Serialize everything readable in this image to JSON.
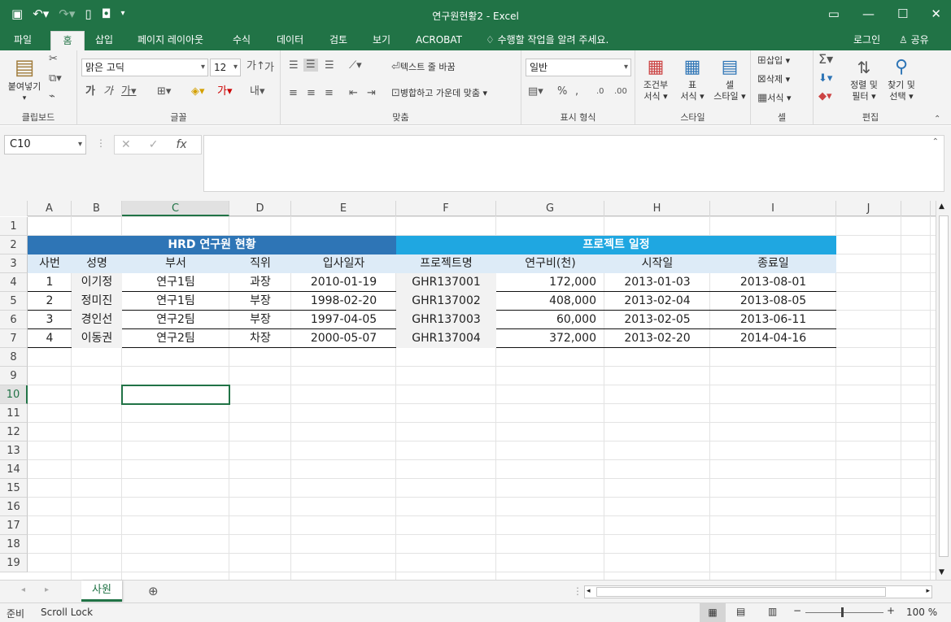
{
  "window": {
    "title": "연구원현황2 - Excel"
  },
  "tabs": [
    "파일",
    "홈",
    "삽입",
    "페이지 레이아웃",
    "수식",
    "데이터",
    "검토",
    "보기",
    "ACROBAT"
  ],
  "tellme": "수행할 작업을 알려 주세요.",
  "login": "로그인",
  "share": "공유",
  "ribbon": {
    "paste": "붙여넣기",
    "clipboard": "클립보드",
    "font_name": "맑은 고딕",
    "font_size": "12",
    "font": "글꼴",
    "wrap_text": "텍스트 줄 바꿈",
    "merge_center": "병합하고 가운데 맞춤",
    "alignment": "맞춤",
    "number_format": "일반",
    "number": "표시 형식",
    "cond_format1": "조건부",
    "cond_format2": "서식",
    "format_table1": "표",
    "format_table2": "서식",
    "cell_styles1": "셀",
    "cell_styles2": "스타일",
    "styles": "스타일",
    "insert": "삽입",
    "delete": "삭제",
    "format": "서식",
    "cells": "셀",
    "sort1": "정렬 및",
    "sort2": "필터",
    "find1": "찾기 및",
    "find2": "선택",
    "editing": "편집"
  },
  "namebox": "C10",
  "columns": [
    "A",
    "B",
    "C",
    "D",
    "E",
    "F",
    "G",
    "H",
    "I",
    "J"
  ],
  "rows": [
    "1",
    "2",
    "3",
    "4",
    "5",
    "6",
    "7",
    "8",
    "9",
    "10",
    "11",
    "12",
    "13",
    "14",
    "15",
    "16",
    "17",
    "18",
    "19"
  ],
  "table": {
    "title_left": "HRD 연구원 현황",
    "title_right": "프로젝트 일정",
    "headers": [
      "사번",
      "성명",
      "부서",
      "직위",
      "입사일자",
      "프로젝트명",
      "연구비(천)",
      "시작일",
      "종료일"
    ],
    "rows": [
      [
        "1",
        "이기정",
        "연구1팀",
        "과장",
        "2010-01-19",
        "GHR137001",
        "172,000",
        "2013-01-03",
        "2013-08-01"
      ],
      [
        "2",
        "정미진",
        "연구1팀",
        "부장",
        "1998-02-20",
        "GHR137002",
        "408,000",
        "2013-02-04",
        "2013-08-05"
      ],
      [
        "3",
        "경인선",
        "연구2팀",
        "부장",
        "1997-04-05",
        "GHR137003",
        "60,000",
        "2013-02-05",
        "2013-06-11"
      ],
      [
        "4",
        "이동권",
        "연구2팀",
        "차장",
        "2000-05-07",
        "GHR137004",
        "372,000",
        "2013-02-20",
        "2014-04-16"
      ]
    ]
  },
  "sheet_tab": "사원",
  "status": {
    "ready": "준비",
    "scroll_lock": "Scroll Lock",
    "zoom": "100 %"
  },
  "colors": {
    "accent": "#217346",
    "blue_header": "#2e75b6",
    "cyan_header": "#1fa7e1",
    "light_header": "#ddebf7"
  }
}
